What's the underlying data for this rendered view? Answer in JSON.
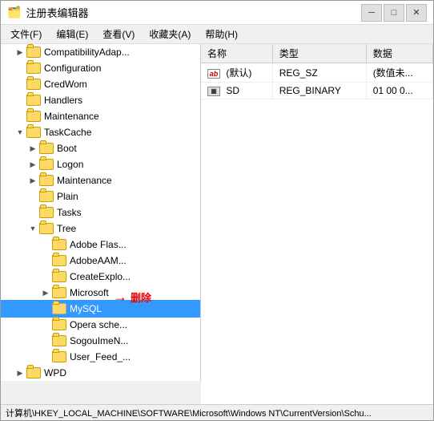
{
  "window": {
    "title": "注册表编辑器",
    "icon": "🗂️"
  },
  "titleControls": {
    "minimize": "─",
    "maximize": "□",
    "close": "✕"
  },
  "menu": {
    "items": [
      {
        "label": "文件(F)"
      },
      {
        "label": "编辑(E)"
      },
      {
        "label": "查看(V)"
      },
      {
        "label": "收藏夹(A)"
      },
      {
        "label": "帮助(H)"
      }
    ]
  },
  "treeNodes": [
    {
      "id": "compat",
      "label": "CompatibilityAdap...",
      "indent": 1,
      "expanded": false
    },
    {
      "id": "config",
      "label": "Configuration",
      "indent": 1,
      "expanded": false
    },
    {
      "id": "credwom",
      "label": "CredWom",
      "indent": 1,
      "expanded": false
    },
    {
      "id": "handlers",
      "label": "Handlers",
      "indent": 1,
      "expanded": false
    },
    {
      "id": "maint",
      "label": "Maintenance",
      "indent": 1,
      "expanded": false
    },
    {
      "id": "taskcache",
      "label": "TaskCache",
      "indent": 1,
      "expanded": true
    },
    {
      "id": "boot",
      "label": "Boot",
      "indent": 2,
      "expanded": false
    },
    {
      "id": "logon",
      "label": "Logon",
      "indent": 2,
      "expanded": false
    },
    {
      "id": "maintenance2",
      "label": "Maintenance",
      "indent": 2,
      "expanded": false
    },
    {
      "id": "plain",
      "label": "Plain",
      "indent": 2,
      "expanded": false
    },
    {
      "id": "tasks",
      "label": "Tasks",
      "indent": 2,
      "expanded": false
    },
    {
      "id": "tree",
      "label": "Tree",
      "indent": 2,
      "expanded": true
    },
    {
      "id": "adobeflas",
      "label": "Adobe Flas...",
      "indent": 3,
      "expanded": false
    },
    {
      "id": "adobeaam",
      "label": "AdobeAAM...",
      "indent": 3,
      "expanded": false
    },
    {
      "id": "createexplo",
      "label": "CreateExplo...",
      "indent": 3,
      "expanded": false
    },
    {
      "id": "microsoft",
      "label": "Microsoft",
      "indent": 3,
      "expanded": false
    },
    {
      "id": "mysql",
      "label": "MySQL",
      "indent": 3,
      "expanded": false,
      "selected": true
    },
    {
      "id": "operasche",
      "label": "Opera sche...",
      "indent": 3,
      "expanded": false
    },
    {
      "id": "sogouime",
      "label": "SogouImeN...",
      "indent": 3,
      "expanded": false
    },
    {
      "id": "userfeed",
      "label": "User_Feed_...",
      "indent": 3,
      "expanded": false
    },
    {
      "id": "wpd",
      "label": "WPD",
      "indent": 1,
      "expanded": false
    }
  ],
  "regTable": {
    "columns": [
      "名称",
      "类型",
      "数据"
    ],
    "rows": [
      {
        "name": "(默认)",
        "namePrefix": "ab",
        "type": "REG_SZ",
        "data": "(数值未..."
      },
      {
        "name": "SD",
        "namePrefix": "bin",
        "type": "REG_BINARY",
        "data": "01 00 0..."
      }
    ]
  },
  "statusBar": {
    "text": "计算机\\HKEY_LOCAL_MACHINE\\SOFTWARE\\Microsoft\\Windows NT\\CurrentVersion\\Schu..."
  },
  "annotation": {
    "label": "删除",
    "arrowSymbol": "→"
  }
}
